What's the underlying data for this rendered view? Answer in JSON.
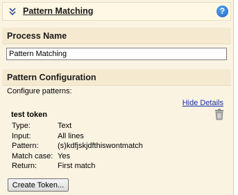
{
  "header": {
    "title": "Pattern Matching",
    "help_glyph": "?"
  },
  "process_name": {
    "heading": "Process Name",
    "value": "Pattern Matching"
  },
  "pattern_config": {
    "heading": "Pattern Configuration",
    "configure_label": "Configure patterns:",
    "hide_details_link": "Hide Details",
    "token": {
      "name": "test token",
      "details": [
        {
          "label": "Type:",
          "value": "Text"
        },
        {
          "label": "Input:",
          "value": "All lines"
        },
        {
          "label": "Pattern:",
          "value": "(s)kdfjskjdfthiswontmatch"
        },
        {
          "label": "Match case:",
          "value": "Yes"
        },
        {
          "label": "Return:",
          "value": "First match"
        }
      ]
    },
    "create_button": "Create Token..."
  },
  "icons": {
    "collapse": "double-chevron-down-icon",
    "help": "help-icon",
    "delete": "trash-icon"
  },
  "colors": {
    "panel_bg": "#fbf3e2",
    "section_bg": "#f5ead0",
    "link": "#1030b0",
    "help_blue": "#1c63c2"
  }
}
